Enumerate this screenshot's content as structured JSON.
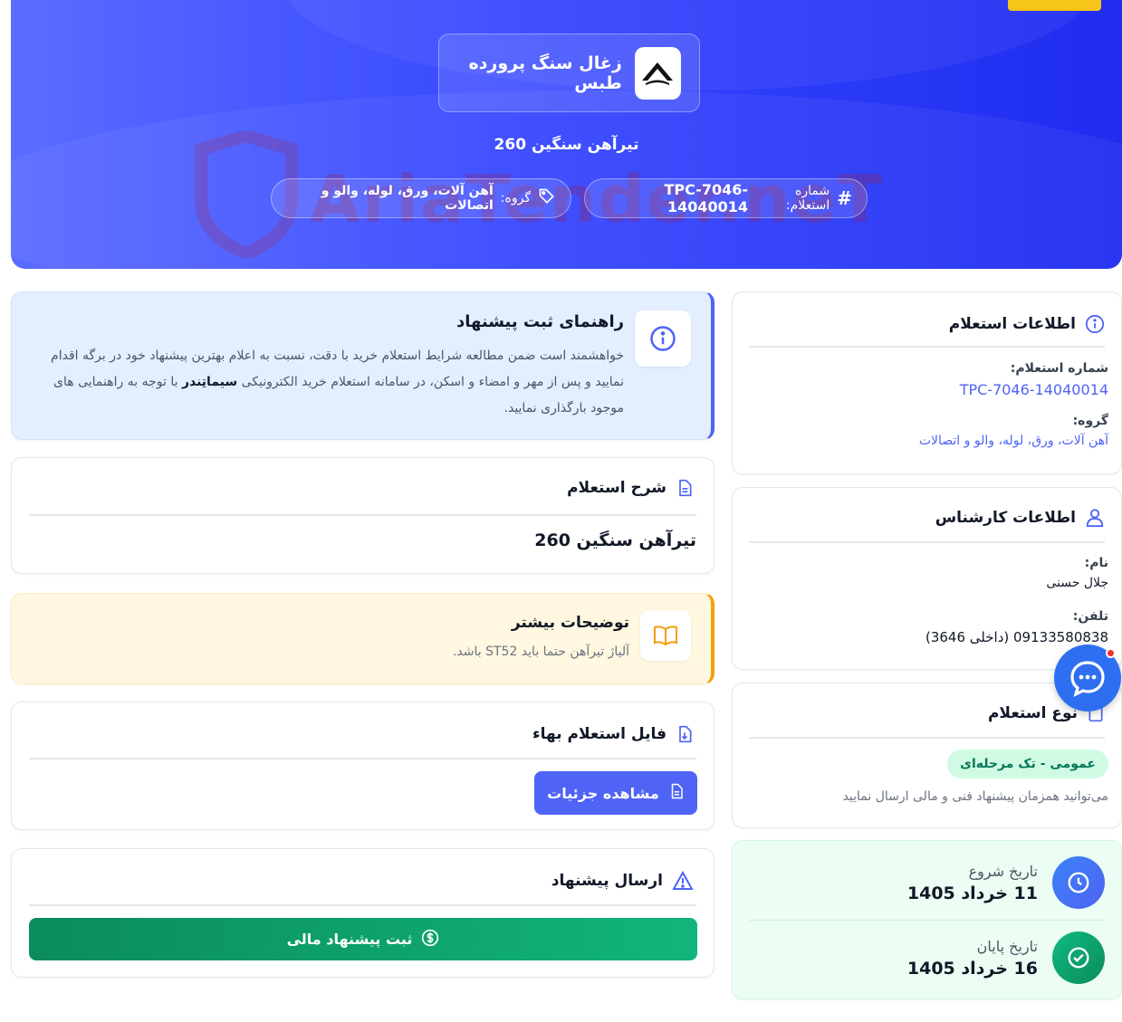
{
  "header": {
    "company_name": "زغال سنگ پرورده طبس",
    "title": "تیرآهن سنگین 260",
    "inquiry_number_label": "شماره استعلام:",
    "inquiry_number": "TPC-7046-14040014",
    "group_label": "گروه:",
    "group": "آهن آلات، ورق، لوله، والو و اتصالات",
    "watermark": "AriaTender.neT"
  },
  "guide": {
    "title": "راهنمای ثبت پیشنهاد",
    "text_before": "خواهشمند است ضمن مطالعه شرایط استعلام خرید با دقت، نسبت به اعلام بهترین پیشنهاد خود در برگه اقدام نمایید و پس از مهر و امضاء و اسکن، در سامانه استعلام خرید الکترونیکی ",
    "brand": "سیماتِندر",
    "text_after": " با توجه به راهنمایی های موجود بارگذاری نمایید."
  },
  "description": {
    "title": "شرح استعلام",
    "value": "تیرآهن سنگین 260"
  },
  "more": {
    "title": "توضیحات بیشتر",
    "value": "آلیاژ تیرآهن حتما باید ST52 باشد."
  },
  "file": {
    "title": "فایل استعلام بهاء",
    "button": "مشاهده جزئیات"
  },
  "send": {
    "title": "ارسال پیشنهاد",
    "button": "ثبت پیشنهاد مالی"
  },
  "inquiry_info": {
    "title": "اطلاعات استعلام",
    "number_label": "شماره استعلام:",
    "number": "TPC-7046-14040014",
    "group_label": "گروه:",
    "group": "آهن آلات، ورق، لوله، والو و اتصالات"
  },
  "expert": {
    "title": "اطلاعات کارشناس",
    "name_label": "نام:",
    "name": "جلال حسنی",
    "phone_label": "تلفن:",
    "phone": "09133580838 (داخلی 3646)"
  },
  "type": {
    "title": "نوع استعلام",
    "badge": "عمومی - تک مرحله‌ای",
    "note": "می‌توانید همزمان پیشنهاد فنی و مالی ارسال نمایید"
  },
  "dates": {
    "start_label": "تاریخ شروع",
    "start": "11 خرداد 1405",
    "end_label": "تاریخ پایان",
    "end": "16 خرداد 1405"
  },
  "colors": {
    "primary": "#4f63f5",
    "hero_start": "#5a6cff",
    "hero_end": "#1f2cf0",
    "success": "#12b57a",
    "warning": "#f59e0b",
    "accent": "#f5c518"
  }
}
